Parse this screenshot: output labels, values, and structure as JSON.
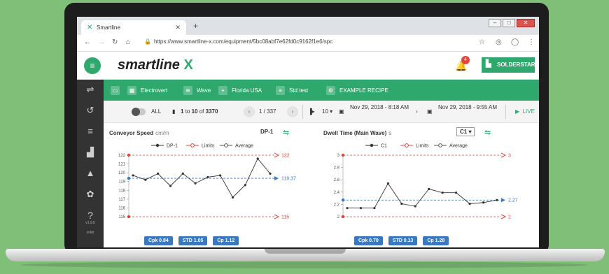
{
  "browser": {
    "tab_title": "Smartline",
    "url": "https://www.smartline-x.com/equipment/5bc08abf7e62fd0c9162f1e6/spc"
  },
  "app": {
    "logo_text": "smartline",
    "logo_mark": "X",
    "notification_count": "4",
    "user_label": "SOLDERSTAR",
    "accent": "#2ea86c"
  },
  "sidebar": {
    "icons": [
      "filter-icon",
      "history-icon",
      "list-icon",
      "chart-icon",
      "warning-icon",
      "settings-icon",
      "help-icon"
    ],
    "version": "v1.9.0",
    "user_short": "soldr"
  },
  "filters": {
    "items": [
      {
        "icon": "monitor-icon",
        "label": ""
      },
      {
        "icon": "calendar-icon",
        "label": "Electrovert"
      },
      {
        "icon": "wave-icon",
        "label": "Wave"
      },
      {
        "icon": "location-icon",
        "label": "Florida USA"
      },
      {
        "icon": "test-icon",
        "label": "Std test"
      },
      {
        "icon": "recipe-icon",
        "label": "EXAMPLE RECIPE"
      }
    ]
  },
  "pager": {
    "all_label": "ALL",
    "range_from": "1",
    "range_to_word": "to",
    "range_to": "10",
    "of_word": "of",
    "total": "3370",
    "page": "1 / 337",
    "per_page": "10 ▾",
    "date_from": "Nov 29, 2018 - 8:18 AM",
    "date_to": "Nov 29, 2018 - 9:55 AM",
    "live_label": "LIVE"
  },
  "charts": {
    "left": {
      "title": "Conveyor Speed",
      "unit": "cm/m",
      "selector": "DP-1",
      "legend_series": "DP-1",
      "legend_limits": "Limits",
      "legend_average": "Average",
      "upper_limit_label": "122",
      "lower_limit_label": "115",
      "average_label": "119.37",
      "y_ticks": [
        "122",
        "121",
        "120",
        "119",
        "118",
        "117",
        "116",
        "115"
      ],
      "stats": [
        "Cpk 0.84",
        "STD 1.05",
        "Cp 1.12"
      ]
    },
    "right": {
      "title": "Dwell Time (Main Wave)",
      "unit": "s",
      "selector": "C1 ▾",
      "legend_series": "C1",
      "legend_limits": "Limits",
      "legend_average": "Average",
      "upper_limit_label": "3",
      "lower_limit_label": "2",
      "average_label": "2.27",
      "y_ticks": [
        "3",
        "2.8",
        "2.6",
        "2.4",
        "2.2",
        "2"
      ],
      "stats": [
        "Cpk 0.70",
        "STD 0.13",
        "Cp 1.28"
      ]
    }
  },
  "chart_data": [
    {
      "type": "line",
      "title": "Conveyor Speed",
      "ylabel": "cm/m",
      "ylim": [
        115,
        122
      ],
      "series": [
        {
          "name": "DP-1",
          "values": [
            119.7,
            119.2,
            119.9,
            118.5,
            119.9,
            118.8,
            119.5,
            119.7,
            117.2,
            118.6,
            121.6,
            119.9
          ]
        }
      ],
      "upper_limit": 122,
      "lower_limit": 115,
      "average": 119.37,
      "colors": {
        "series": "#333333",
        "limits": "#e0463b",
        "average": "#3b78c2"
      }
    },
    {
      "type": "line",
      "title": "Dwell Time (Main Wave)",
      "ylabel": "s",
      "ylim": [
        2,
        3
      ],
      "series": [
        {
          "name": "C1",
          "values": [
            2.14,
            2.14,
            2.14,
            2.54,
            2.21,
            2.17,
            2.45,
            2.39,
            2.39,
            2.21,
            2.23,
            2.27
          ]
        }
      ],
      "upper_limit": 3,
      "lower_limit": 2,
      "average": 2.27,
      "colors": {
        "series": "#333333",
        "limits": "#e0463b",
        "average": "#3b78c2"
      }
    }
  ]
}
